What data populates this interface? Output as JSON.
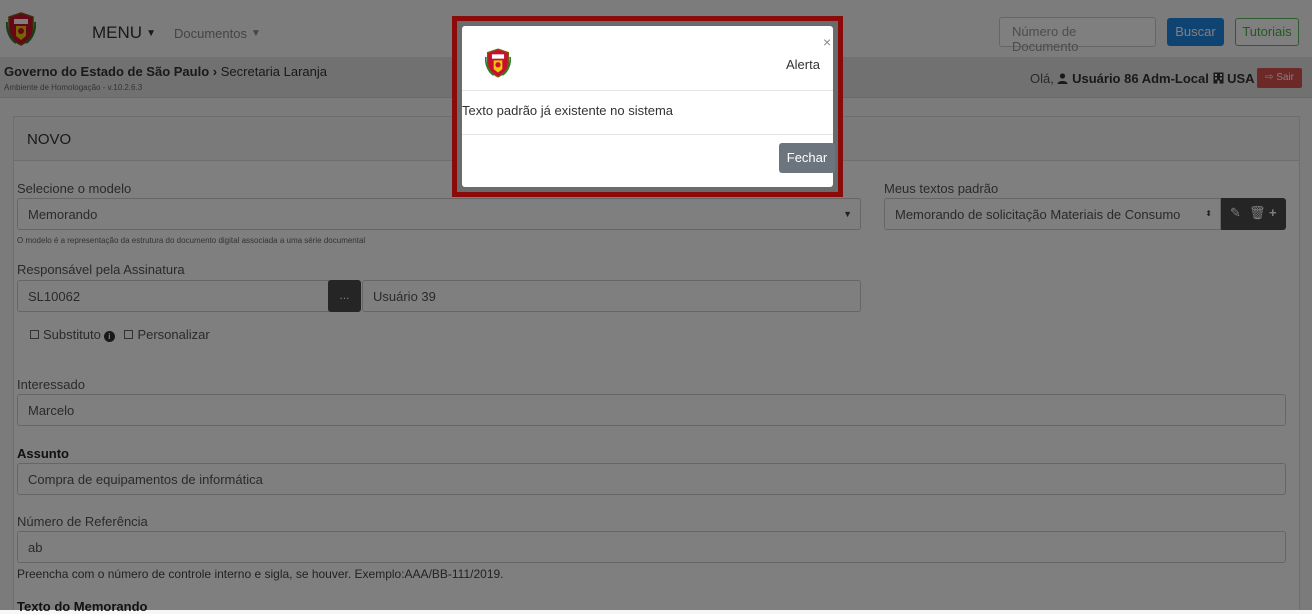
{
  "navbar": {
    "menu_label": "MENU",
    "documents_label": "Documentos",
    "search_placeholder": "Número de Documento",
    "search_button": "Buscar",
    "tutorials_button": "Tutoriais"
  },
  "subheader": {
    "org_bold": "Governo do Estado de São Paulo",
    "org_separator": "›",
    "org_secretaria": "Secretaria Laranja",
    "environment": "Ambiente de Homologação - v.10.2.6.3",
    "greeting": "Olá,",
    "user_name": "Usuário 86 Adm-Local",
    "user_unit": "USA",
    "logout_label": "Sair"
  },
  "panel": {
    "title": "NOVO",
    "modelo_label": "Selecione o modelo",
    "modelo_value": "Memorando",
    "modelo_help": "O modelo é a representação da estrutura do documento digital associada a uma série documental",
    "textos_label": "Meus textos padrão",
    "textos_value": "Memorando de solicitação Materiais de Consumo",
    "responsavel_label": "Responsável pela Assinatura",
    "responsavel_code": "SL10062",
    "responsavel_button": "...",
    "responsavel_name": "Usuário 39",
    "substituto_label": "Substituto",
    "personalizar_label": "Personalizar",
    "interessado_label": "Interessado",
    "interessado_value": "Marcelo",
    "assunto_label": "Assunto",
    "assunto_value": "Compra de equipamentos de informática",
    "referencia_label": "Número de Referência",
    "referencia_value": "ab",
    "referencia_help": "Preencha com o número de controle interno e sigla, se houver. Exemplo:AAA/BB-111/2019.",
    "texto_label": "Texto do Memorando"
  },
  "modal": {
    "title": "Alerta",
    "close": "×",
    "message": "Texto padrão já existente no sistema",
    "close_button": "Fechar"
  },
  "colors": {
    "primary": "#1e88e5",
    "success": "#5cb85c",
    "danger": "#d9534f",
    "highlight_frame": "#8b0a0a"
  }
}
